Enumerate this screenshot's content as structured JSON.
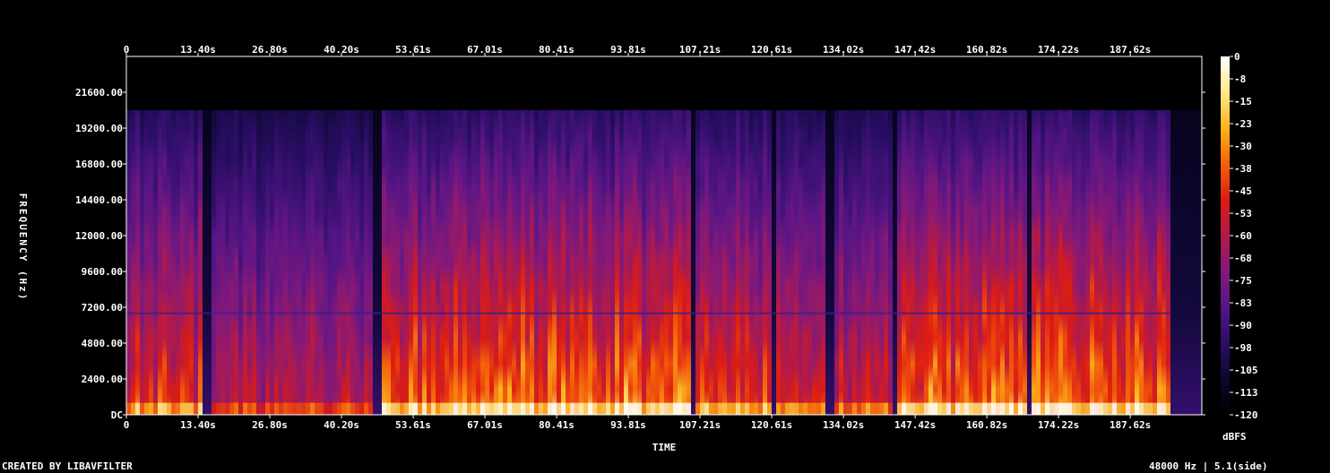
{
  "chart_data": {
    "type": "heatmap",
    "title": "",
    "xlabel": "TIME",
    "ylabel": "FREQUENCY (Hz)",
    "x_ticks": [
      "0",
      "13.40s",
      "26.80s",
      "40.20s",
      "53.61s",
      "67.01s",
      "80.41s",
      "93.81s",
      "107.21s",
      "120.61s",
      "134.02s",
      "147.42s",
      "160.82s",
      "174.22s",
      "187.62s"
    ],
    "x_tick_values": [
      0,
      13.4,
      26.8,
      40.2,
      53.61,
      67.01,
      80.41,
      93.81,
      107.21,
      120.61,
      134.02,
      147.42,
      160.82,
      174.22,
      187.62
    ],
    "xlim": [
      0,
      201.0
    ],
    "y_ticks": [
      "DC",
      "2400.00",
      "4800.00",
      "7200.00",
      "9600.00",
      "12000.00",
      "14400.00",
      "16800.00",
      "19200.00",
      "21600.00"
    ],
    "y_tick_values": [
      0,
      2400,
      4800,
      7200,
      9600,
      12000,
      14400,
      16800,
      19200,
      21600
    ],
    "ylim": [
      0,
      24000
    ],
    "content_cutoff_hz": 20400,
    "noise_line_hz": 6800,
    "colorbar": {
      "label": "dBFS",
      "ticks": [
        "0",
        "-8",
        "-15",
        "-23",
        "-30",
        "-38",
        "-45",
        "-53",
        "-60",
        "-68",
        "-75",
        "-83",
        "-90",
        "-98",
        "-105",
        "-113",
        "-120"
      ],
      "range": [
        -120,
        0
      ],
      "colormap": [
        "#000000",
        "#0c0730",
        "#2a0e66",
        "#561585",
        "#82197a",
        "#b11a4a",
        "#dd1c12",
        "#f4600a",
        "#fcb41c",
        "#fde888",
        "#ffffff"
      ]
    },
    "quiet_segments_s": [
      [
        14.5,
        15.5
      ],
      [
        46.2,
        47.6
      ],
      [
        105.7,
        106.7
      ],
      [
        120.2,
        121.8
      ],
      [
        131.0,
        132.2
      ],
      [
        142.9,
        144.0
      ],
      [
        168.5,
        169.5
      ],
      [
        195.0,
        201.0
      ]
    ],
    "level_segments_s": [
      {
        "range": [
          0,
          14.5
        ],
        "level": 0.62
      },
      {
        "range": [
          15.5,
          46.2
        ],
        "level": 0.5
      },
      {
        "range": [
          47.6,
          105.7
        ],
        "level": 0.7
      },
      {
        "range": [
          106.7,
          120.2
        ],
        "level": 0.62
      },
      {
        "range": [
          121.8,
          142.9
        ],
        "level": 0.55
      },
      {
        "range": [
          144.0,
          168.5
        ],
        "level": 0.7
      },
      {
        "range": [
          169.5,
          195.0
        ],
        "level": 0.72
      }
    ]
  },
  "footer": {
    "credits": "CREATED BY LIBAVFILTER",
    "info": "48000 Hz | 5.1(side)"
  }
}
